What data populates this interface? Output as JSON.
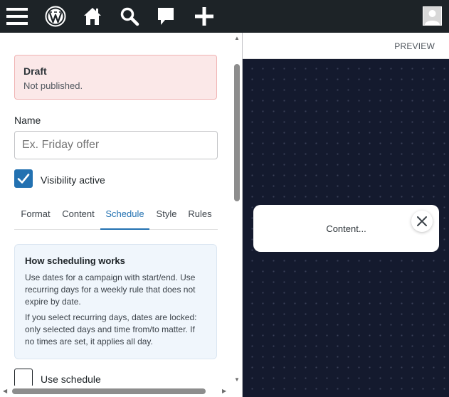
{
  "admin_bar": {
    "icons": [
      "menu-icon",
      "wordpress-logo-icon",
      "home-icon",
      "search-icon",
      "comments-icon",
      "plus-icon",
      "avatar"
    ]
  },
  "notice": {
    "title": "Draft",
    "subtitle": "Not published."
  },
  "name_field": {
    "label": "Name",
    "placeholder": "Ex. Friday offer",
    "value": ""
  },
  "visibility": {
    "label": "Visibility active",
    "checked": true
  },
  "tabs": [
    {
      "label": "Format",
      "active": false
    },
    {
      "label": "Content",
      "active": false
    },
    {
      "label": "Schedule",
      "active": true
    },
    {
      "label": "Style",
      "active": false
    },
    {
      "label": "Rules",
      "active": false
    }
  ],
  "info": {
    "title": "How scheduling works",
    "paragraph1": "Use dates for a campaign with start/end. Use recurring days for a weekly rule that does not expire by date.",
    "paragraph2": "If you select recurring days, dates are locked: only selected days and time from/to matter. If no times are set, it applies all day."
  },
  "use_schedule": {
    "label": "Use schedule",
    "checked": false
  },
  "preview": {
    "header": "PREVIEW",
    "popup_text": "Content..."
  },
  "colors": {
    "admin_bar": "#1d2327",
    "accent": "#2271b1",
    "notice_bg": "#fbe8e8",
    "info_bg": "#f0f6fc",
    "preview_bg": "#141a2e"
  }
}
